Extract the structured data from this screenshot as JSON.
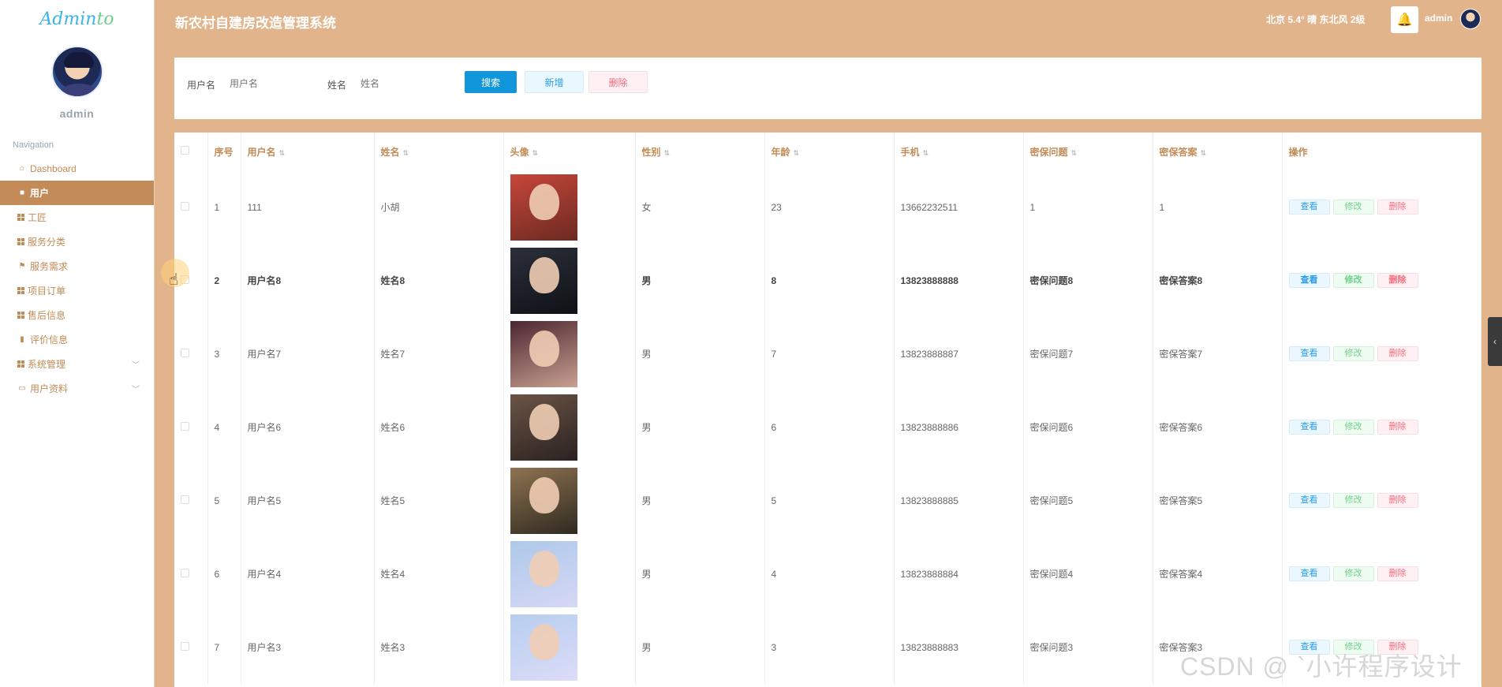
{
  "app": {
    "logo_main": "Admin",
    "logo_accent": "to",
    "system_title": "新农村自建房改造管理系统",
    "weather": "北京 5.4° 晴 东北风 2级",
    "top_user": "admin"
  },
  "sidebar": {
    "user_name": "admin",
    "nav_title": "Navigation",
    "items": [
      {
        "label": "Dashboard",
        "icon": "home-icon"
      },
      {
        "label": "用户",
        "icon": "chat-icon",
        "active": true
      },
      {
        "label": "工匠",
        "icon": "grid-icon"
      },
      {
        "label": "服务分类",
        "icon": "grid-icon"
      },
      {
        "label": "服务需求",
        "icon": "flag-icon"
      },
      {
        "label": "项目订单",
        "icon": "grid-icon"
      },
      {
        "label": "售后信息",
        "icon": "grid-icon"
      },
      {
        "label": "评价信息",
        "icon": "bar-chart-icon"
      },
      {
        "label": "系统管理",
        "icon": "grid-icon",
        "expandable": true
      },
      {
        "label": "用户资料",
        "icon": "calendar-icon",
        "expandable": true
      }
    ]
  },
  "search": {
    "username_label": "用户名",
    "username_placeholder": "用户名",
    "name_label": "姓名",
    "name_placeholder": "姓名",
    "search_btn": "搜索",
    "add_btn": "新增",
    "delete_btn": "删除"
  },
  "table": {
    "headers": [
      "序号",
      "用户名",
      "姓名",
      "头像",
      "性别",
      "年龄",
      "手机",
      "密保问题",
      "密保答案",
      "操作"
    ],
    "action_view": "查看",
    "action_edit": "修改",
    "action_delete": "删除",
    "rows": [
      {
        "no": "1",
        "username": "111",
        "name": "小胡",
        "gender": "女",
        "age": "23",
        "phone": "13662232511",
        "question": "1",
        "answer": "1"
      },
      {
        "no": "2",
        "username": "用户名8",
        "name": "姓名8",
        "gender": "男",
        "age": "8",
        "phone": "13823888888",
        "question": "密保问题8",
        "answer": "密保答案8"
      },
      {
        "no": "3",
        "username": "用户名7",
        "name": "姓名7",
        "gender": "男",
        "age": "7",
        "phone": "13823888887",
        "question": "密保问题7",
        "answer": "密保答案7"
      },
      {
        "no": "4",
        "username": "用户名6",
        "name": "姓名6",
        "gender": "男",
        "age": "6",
        "phone": "13823888886",
        "question": "密保问题6",
        "answer": "密保答案6"
      },
      {
        "no": "5",
        "username": "用户名5",
        "name": "姓名5",
        "gender": "男",
        "age": "5",
        "phone": "13823888885",
        "question": "密保问题5",
        "answer": "密保答案5"
      },
      {
        "no": "6",
        "username": "用户名4",
        "name": "姓名4",
        "gender": "男",
        "age": "4",
        "phone": "13823888884",
        "question": "密保问题4",
        "answer": "密保答案4"
      },
      {
        "no": "7",
        "username": "用户名3",
        "name": "姓名3",
        "gender": "男",
        "age": "3",
        "phone": "13823888883",
        "question": "密保问题3",
        "answer": "密保答案3"
      }
    ]
  },
  "watermark": "CSDN @ `小许程序设计",
  "colors": {
    "page_bg": "#e2b48c",
    "accent": "#c28b57",
    "primary_button": "#1296db"
  }
}
